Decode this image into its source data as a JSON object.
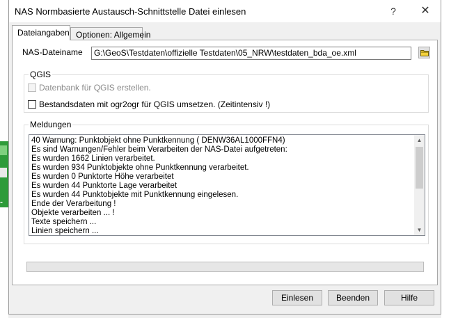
{
  "background": {
    "widget_text": "-K"
  },
  "window": {
    "title": "NAS Normbasierte Austausch-Schnittstelle Datei einlesen",
    "help_icon": "?",
    "close_icon": "✕"
  },
  "tabs": [
    {
      "label": "Dateiangaben",
      "active": true
    },
    {
      "label": "Optionen: Allgemein",
      "active": false
    }
  ],
  "file": {
    "label": "NAS-Dateiname",
    "value": "G:\\GeoS\\Testdaten\\offizielle Testdaten\\05_NRW\\testdaten_bda_oe.xml",
    "browse_icon": "folder-icon"
  },
  "qgis": {
    "title": "QGIS",
    "options": [
      {
        "label": "Datenbank für QGIS erstellen.",
        "checked": false,
        "enabled": false
      },
      {
        "label": "Bestandsdaten mit ogr2ogr für QGIS umsetzen. (Zeitintensiv !)",
        "checked": false,
        "enabled": true
      }
    ]
  },
  "messages": {
    "title": "Meldungen",
    "lines": [
      "40 Warnung: Punktobjekt ohne Punktkennung (                         DENW36AL1000FFN4)",
      "Es sind Warnungen/Fehler beim Verarbeiten der NAS-Datei aufgetreten:",
      "Es wurden 1662 Linien verarbeitet.",
      "Es wurden 934 Punktobjekte ohne Punktkennung verarbeitet.",
      "Es wurden 0 Punktorte Höhe verarbeitet",
      "Es wurden 44 Punktorte Lage verarbeitet",
      "Es wurden 44 Punktobjekte mit Punktkennung eingelesen.",
      "Ende der Verarbeitung !",
      "Objekte verarbeiten ... !",
      "Texte speichern ...",
      "Linien speichern ..."
    ]
  },
  "progress": {
    "value": 0
  },
  "buttons": {
    "read": "Einlesen",
    "exit": "Beenden",
    "help": "Hilfe"
  }
}
